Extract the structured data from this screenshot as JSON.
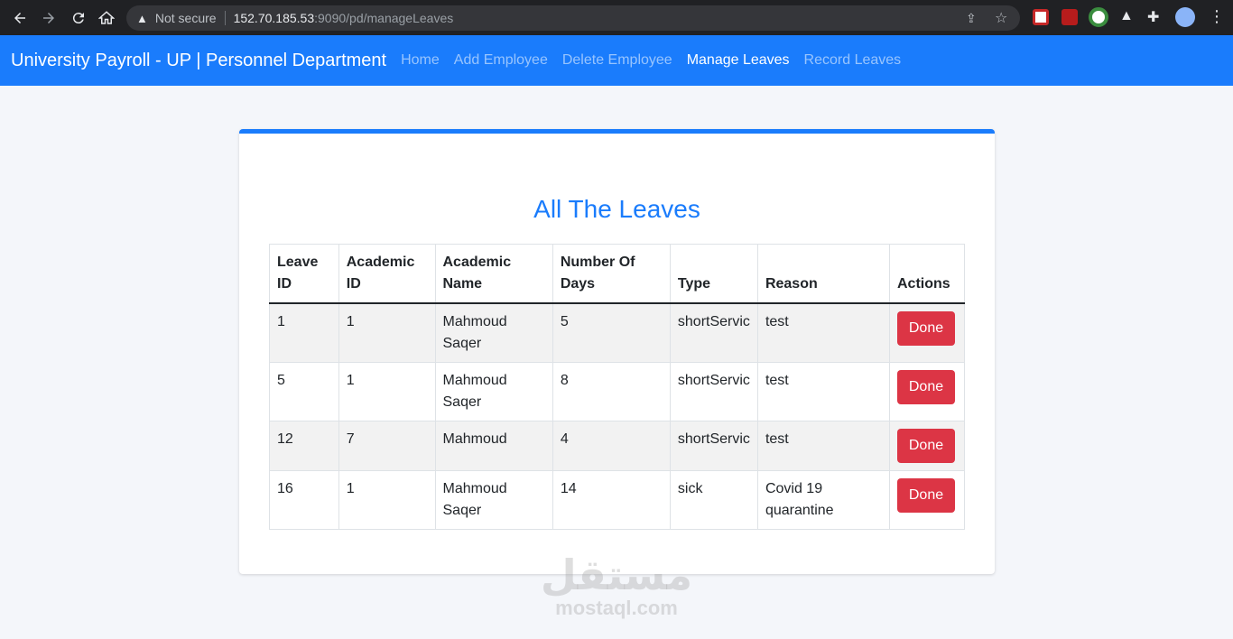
{
  "browser": {
    "security_label": "Not secure",
    "url_host": "152.70.185.53",
    "url_rest": ":9090/pd/manageLeaves"
  },
  "navbar": {
    "brand": "University Payroll - UP | Personnel Department",
    "links": [
      {
        "label": "Home",
        "active": false
      },
      {
        "label": "Add Employee",
        "active": false
      },
      {
        "label": "Delete Employee",
        "active": false
      },
      {
        "label": "Manage Leaves",
        "active": true
      },
      {
        "label": "Record Leaves",
        "active": false
      }
    ]
  },
  "main": {
    "title": "All The Leaves",
    "table": {
      "headers": [
        "Leave ID",
        "Academic ID",
        "Academic Name",
        "Number Of Days",
        "Type",
        "Reason",
        "Actions"
      ],
      "rows": [
        {
          "leave_id": "1",
          "academic_id": "1",
          "academic_name": "Mahmoud Saqer",
          "days": "5",
          "type": "shortServic",
          "reason": "test",
          "action": "Done"
        },
        {
          "leave_id": "5",
          "academic_id": "1",
          "academic_name": "Mahmoud Saqer",
          "days": "8",
          "type": "shortServic",
          "reason": "test",
          "action": "Done"
        },
        {
          "leave_id": "12",
          "academic_id": "7",
          "academic_name": "Mahmoud",
          "days": "4",
          "type": "shortServic",
          "reason": "test",
          "action": "Done"
        },
        {
          "leave_id": "16",
          "academic_id": "1",
          "academic_name": "Mahmoud Saqer",
          "days": "14",
          "type": "sick",
          "reason": "Covid 19 quarantine",
          "action": "Done"
        }
      ]
    }
  },
  "watermark": {
    "arabic": "مستقل",
    "latin": "mostaql.com"
  },
  "colors": {
    "primary": "#1a7cfc",
    "danger": "#dc3545"
  }
}
